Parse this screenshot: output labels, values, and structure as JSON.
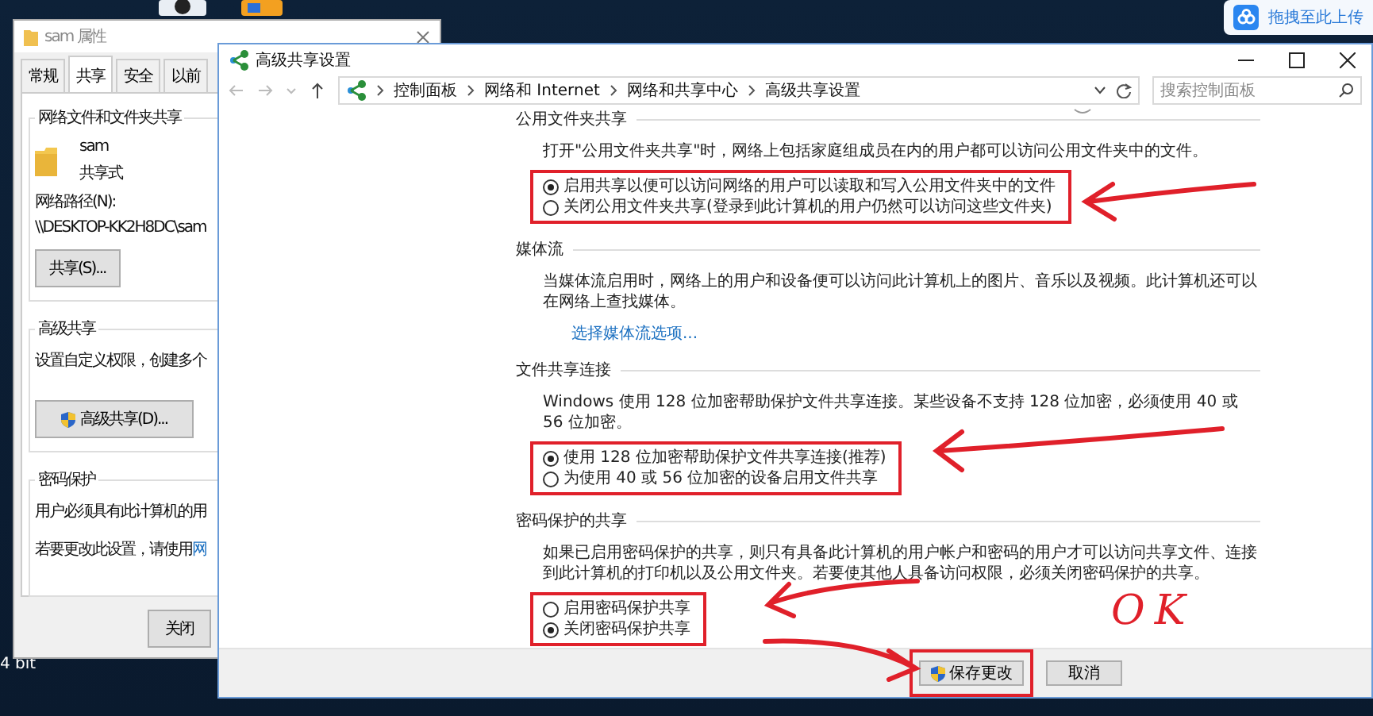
{
  "desktop": {
    "label": "4 bit"
  },
  "upload_widget": {
    "label": "拖拽至此上传"
  },
  "properties_window": {
    "title": "sam 属性",
    "tabs": [
      {
        "label": "常规",
        "selected": false
      },
      {
        "label": "共享",
        "selected": true
      },
      {
        "label": "安全",
        "selected": false
      },
      {
        "label": "以前",
        "selected": false
      }
    ],
    "network_sharing": {
      "heading": "网络文件和文件夹共享",
      "name": "sam",
      "status": "共享式",
      "path_label": "网络路径(N):",
      "path": "\\\\DESKTOP-KK2H8DC\\sam",
      "button": "共享(S)..."
    },
    "advanced_sharing": {
      "heading": "高级共享",
      "description": "设置自定义权限，创建多个",
      "button": "高级共享(D)..."
    },
    "password_protection": {
      "heading": "密码保护",
      "description": "用户必须具有此计算机的用",
      "hint": "若要更改此设置，请使用",
      "link": "网"
    },
    "buttons": [
      "关闭"
    ]
  },
  "settings_window": {
    "title": "高级共享设置",
    "breadcrumb": [
      "控制面板",
      "网络和 Internet",
      "网络和共享中心",
      "高级共享设置"
    ],
    "search": {
      "placeholder": "搜索控制面板"
    },
    "sections": [
      {
        "heading": "公用文件夹共享",
        "description": "打开\"公用文件夹共享\"时，网络上包括家庭组成员在内的用户都可以访问公用文件夹中的文件。",
        "highlighted": true,
        "options": [
          {
            "label": "启用共享以便可以访问网络的用户可以读取和写入公用文件夹中的文件",
            "selected": true
          },
          {
            "label": "关闭公用文件夹共享(登录到此计算机的用户仍然可以访问这些文件夹)",
            "selected": false
          }
        ]
      },
      {
        "heading": "媒体流",
        "description": "当媒体流启用时，网络上的用户和设备便可以访问此计算机上的图片、音乐以及视频。此计算机还可以在网络上查找媒体。",
        "link": "选择媒体流选项..."
      },
      {
        "heading": "文件共享连接",
        "description": "Windows 使用 128 位加密帮助保护文件共享连接。某些设备不支持 128 位加密，必须使用 40 或 56 位加密。",
        "highlighted": true,
        "options": [
          {
            "label": "使用 128 位加密帮助保护文件共享连接(推荐)",
            "selected": true
          },
          {
            "label": "为使用 40 或 56 位加密的设备启用文件共享",
            "selected": false
          }
        ]
      },
      {
        "heading": "密码保护的共享",
        "description": "如果已启用密码保护的共享，则只有具备此计算机的用户帐户和密码的用户才可以访问共享文件、连接到此计算机的打印机以及公用文件夹。若要使其他人具备访问权限，必须关闭密码保护的共享。",
        "highlighted": true,
        "options": [
          {
            "label": "启用密码保护共享",
            "selected": false
          },
          {
            "label": "关闭密码保护共享",
            "selected": true
          }
        ]
      }
    ],
    "buttons": [
      {
        "label": "保存更改",
        "kind": "shield",
        "highlighted": true
      },
      {
        "label": "取消",
        "kind": "plain",
        "highlighted": false
      }
    ]
  },
  "annotation": {
    "text": "OK"
  }
}
